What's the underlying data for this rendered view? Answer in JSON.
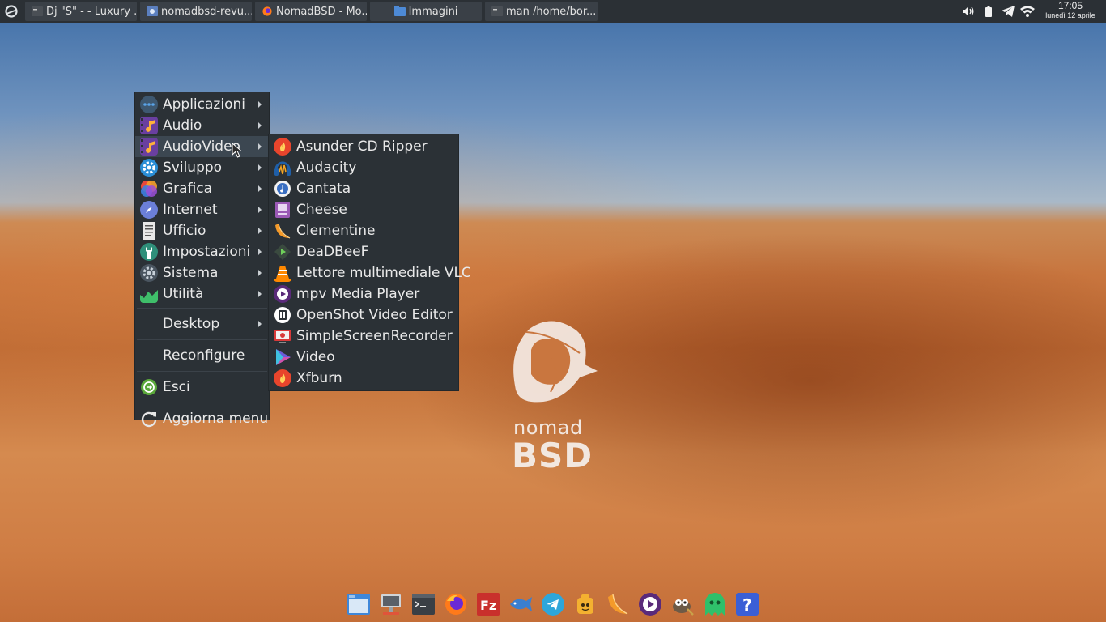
{
  "panel": {
    "tasks": [
      {
        "label": "Dj \"S\" -  - Luxury ..."
      },
      {
        "label": "nomadbsd-revu..."
      },
      {
        "label": "NomadBSD - Mo..."
      },
      {
        "label": "Immagini"
      },
      {
        "label": "man /home/bor..."
      }
    ],
    "clock": {
      "time": "17:05",
      "date": "lunedì 12 aprile"
    }
  },
  "main_menu": {
    "items": [
      {
        "label": "Applicazioni"
      },
      {
        "label": "Audio"
      },
      {
        "label": "AudioVideo"
      },
      {
        "label": "Sviluppo"
      },
      {
        "label": "Grafica"
      },
      {
        "label": "Internet"
      },
      {
        "label": "Ufficio"
      },
      {
        "label": "Impostazioni"
      },
      {
        "label": "Sistema"
      },
      {
        "label": "Utilità"
      }
    ],
    "desktop": "Desktop",
    "reconfigure": "Reconfigure",
    "exit": "Esci",
    "refresh": "Aggiorna menu"
  },
  "submenu": {
    "items": [
      {
        "label": "Asunder CD Ripper",
        "icon": "asunder-icon"
      },
      {
        "label": "Audacity",
        "icon": "audacity-icon"
      },
      {
        "label": "Cantata",
        "icon": "cantata-icon"
      },
      {
        "label": "Cheese",
        "icon": "cheese-icon"
      },
      {
        "label": "Clementine",
        "icon": "clementine-icon"
      },
      {
        "label": "DeaDBeeF",
        "icon": "deadbeef-icon"
      },
      {
        "label": "Lettore multimediale VLC",
        "icon": "vlc-icon"
      },
      {
        "label": "mpv Media Player",
        "icon": "mpv-icon"
      },
      {
        "label": "OpenShot Video Editor",
        "icon": "openshot-icon"
      },
      {
        "label": "SimpleScreenRecorder",
        "icon": "ssr-icon"
      },
      {
        "label": "Video",
        "icon": "video-icon"
      },
      {
        "label": "Xfburn",
        "icon": "xfburn-icon"
      }
    ]
  },
  "logo": {
    "line1": "nomad",
    "line2": "BSD"
  },
  "colors": {
    "panel_bg": "#2b3035",
    "menu_bg": "#2b3136",
    "menu_active": "#3c4751"
  }
}
